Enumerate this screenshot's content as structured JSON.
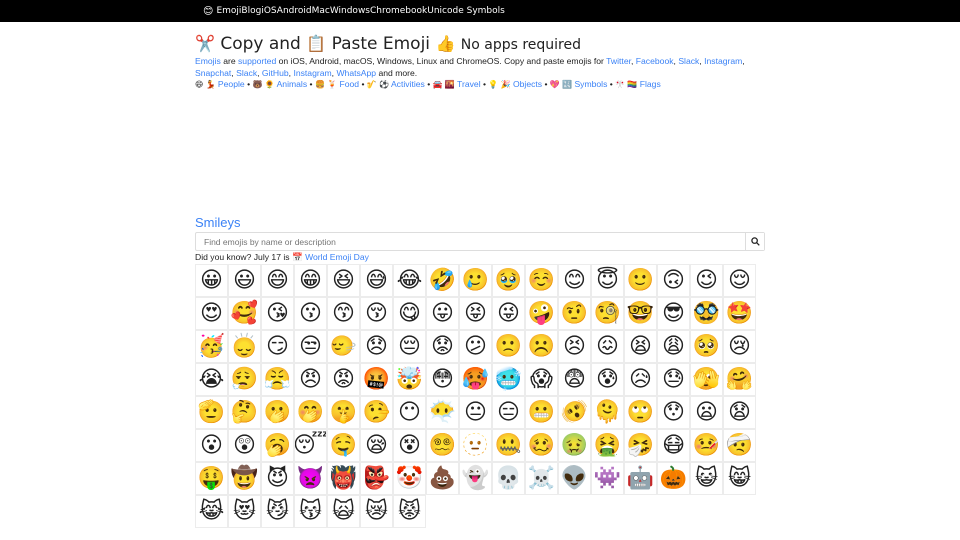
{
  "topbar": {
    "icon": "😊",
    "links": [
      "Emoji",
      "Blog",
      "iOS",
      "Android",
      "Mac",
      "Windows",
      "Chromebook",
      "Unicode Symbols"
    ]
  },
  "header": {
    "icon1": "✂️",
    "copy_word": "Copy",
    "and_word": "and",
    "icon2": "📋",
    "paste_word": "Paste Emoji",
    "icon3": "👍",
    "tagline": "No apps required"
  },
  "intro": {
    "link_emojis": "Emojis",
    "text_are": "are",
    "link_supported": "supported",
    "text_platforms": "on iOS, Android, macOS, Windows, Linux and ChromeOS. Copy and paste emojis for",
    "apps": [
      "Twitter",
      "Facebook",
      "Slack",
      "Instagram",
      "Snapchat",
      "Slack",
      "GitHub",
      "Instagram",
      "WhatsApp"
    ],
    "text_more": "and more."
  },
  "categories": [
    {
      "icons": "😄 💃",
      "label": "People"
    },
    {
      "icons": "🐻 🌻",
      "label": "Animals"
    },
    {
      "icons": "🍔 🍹",
      "label": "Food"
    },
    {
      "icons": "🎷 ⚽",
      "label": "Activities"
    },
    {
      "icons": "🚘 🌇",
      "label": "Travel"
    },
    {
      "icons": "💡 🎉",
      "label": "Objects"
    },
    {
      "icons": "💖 🔣",
      "label": "Symbols"
    },
    {
      "icons": "🎌 🏳️‍🌈",
      "label": "Flags"
    }
  ],
  "category_separator": "•",
  "section_title": "Smileys",
  "search": {
    "placeholder": "Find emojis by name or description",
    "icon": "search-icon"
  },
  "did_you_know": {
    "text": "Did you know? July 17 is",
    "icon": "📅",
    "link": "World Emoji Day"
  },
  "emojis": [
    "😀",
    "😃",
    "😄",
    "😁",
    "😆",
    "😅",
    "😂",
    "🤣",
    "🥲",
    "🥹",
    "☺️",
    "😊",
    "😇",
    "🙂",
    "🙃",
    "😉",
    "😌",
    "😍",
    "🥰",
    "😘",
    "😗",
    "😙",
    "😚",
    "😋",
    "😛",
    "😝",
    "😜",
    "🤪",
    "🤨",
    "🧐",
    "🤓",
    "😎",
    "🥸",
    "🤩",
    "🥳",
    "🙂‍↕️",
    "😏",
    "😒",
    "🙂‍↔️",
    "😞",
    "😔",
    "😟",
    "😕",
    "🙁",
    "☹️",
    "😣",
    "😖",
    "😫",
    "😩",
    "🥺",
    "😢",
    "😭",
    "😮‍💨",
    "😤",
    "😠",
    "😡",
    "🤬",
    "🤯",
    "😳",
    "🥵",
    "🥶",
    "😱",
    "😨",
    "😰",
    "😥",
    "😓",
    "🫣",
    "🤗",
    "🫡",
    "🤔",
    "🫢",
    "🤭",
    "🤫",
    "🤥",
    "😶",
    "😶‍🌫️",
    "😐",
    "😑",
    "😬",
    "🫨",
    "🫠",
    "🙄",
    "😯",
    "😦",
    "😧",
    "😮",
    "😲",
    "🥱",
    "😴",
    "🤤",
    "😪",
    "😵",
    "😵‍💫",
    "🫥",
    "🤐",
    "🥴",
    "🤢",
    "🤮",
    "🤧",
    "😷",
    "🤒",
    "🤕",
    "🤑",
    "🤠",
    "😈",
    "👿",
    "👹",
    "👺",
    "🤡",
    "💩",
    "👻",
    "💀",
    "☠️",
    "👽",
    "👾",
    "🤖",
    "🎃",
    "😺",
    "😸",
    "😹",
    "😻",
    "😼",
    "😽",
    "🙀",
    "😿",
    "😾"
  ]
}
